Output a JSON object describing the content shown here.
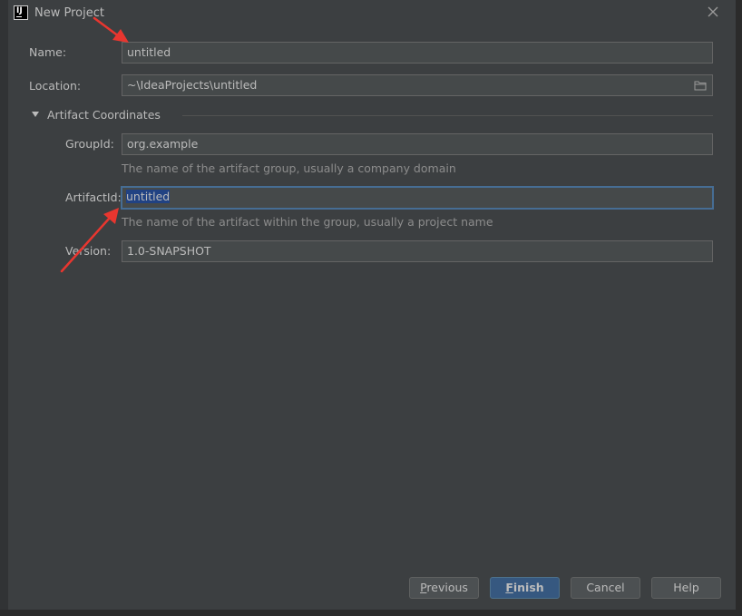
{
  "window": {
    "title": "New Project",
    "icon": "intellij-icon"
  },
  "form": {
    "name": {
      "label": "Name:",
      "value": "untitled"
    },
    "location": {
      "label": "Location:",
      "value": "~\\IdeaProjects\\untitled"
    },
    "section": {
      "label": "Artifact Coordinates",
      "expanded": true
    },
    "group_id": {
      "label": "GroupId:",
      "value": "org.example",
      "hint": "The name of the artifact group, usually a company domain"
    },
    "artifact_id": {
      "label": "ArtifactId:",
      "value": "untitled",
      "hint": "The name of the artifact within the group, usually a project name"
    },
    "version": {
      "label": "Version:",
      "value": "1.0-SNAPSHOT"
    }
  },
  "buttons": {
    "previous_mn": "P",
    "previous_rest": "revious",
    "finish_mn": "F",
    "finish_rest": "inish",
    "cancel": "Cancel",
    "help": "Help"
  },
  "colors": {
    "background": "#3c3f41",
    "field_bg": "#45494a",
    "focus_border": "#466d94",
    "primary_button": "#365880",
    "annotation_arrow": "#e8362f"
  }
}
